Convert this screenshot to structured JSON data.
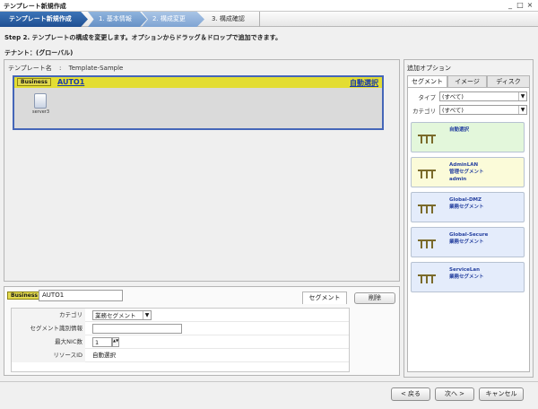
{
  "window": {
    "title": "テンプレート新規作成",
    "min": "_",
    "max": "□",
    "close": "×"
  },
  "steps": {
    "active": "テンプレート新規作成",
    "step1": "1. 基本情報",
    "step2": "2. 構成変更",
    "step3": "3. 構成確認"
  },
  "instruction": "Step 2. テンプレートの構成を変更します。オプションからドラッグ＆ドロップで追加できます。",
  "tenant": "テナント：(グローバル)",
  "canvas": {
    "template_label": "テンプレート名",
    "template_sep": ":",
    "template_name": "Template-Sample",
    "business_badge": "Business",
    "business_name": "AUTO1",
    "auto_select": "自動選択",
    "server_label": "server3"
  },
  "details": {
    "badge": "Business",
    "name_value": "AUTO1",
    "tab_segment": "セグメント",
    "delete_label": "削除",
    "rows": [
      {
        "key": "カテゴリ",
        "value": "業務セグメント",
        "arrow": "▼"
      },
      {
        "key": "セグメント識別情報",
        "value": ""
      },
      {
        "key": "最大NIC数",
        "value": "1",
        "spin": "▲▼"
      },
      {
        "key": "リソースID",
        "value": "自動選択"
      }
    ]
  },
  "options": {
    "title": "追加オプション",
    "tabs": [
      "セグメント",
      "イメージ",
      "ディスク"
    ],
    "filters": [
      {
        "key": "タイプ",
        "value": "(すべて)",
        "arrow": "▼"
      },
      {
        "key": "カテゴリ",
        "value": "(すべて)",
        "arrow": "▼"
      }
    ],
    "cards": [
      {
        "lines": [
          "自動選択"
        ],
        "bg": "#e3f7db"
      },
      {
        "lines": [
          "AdminLAN",
          "管理セグメント",
          "admin"
        ],
        "bg": "#fbfbd9"
      },
      {
        "lines": [
          "Global-DMZ",
          "業務セグメント"
        ],
        "bg": "#e4ecfb"
      },
      {
        "lines": [
          "Global-Secure",
          "業務セグメント"
        ],
        "bg": "#e4ecfb"
      },
      {
        "lines": [
          "ServiceLan",
          "業務セグメント"
        ],
        "bg": "#e4ecfb"
      }
    ]
  },
  "buttons": {
    "back": "< 戻る",
    "next": "次へ >",
    "cancel": "キャンセル"
  },
  "colors": {
    "accent": "#1f4f92",
    "business_bar": "#e3dd33",
    "link": "#1a3aa8"
  }
}
